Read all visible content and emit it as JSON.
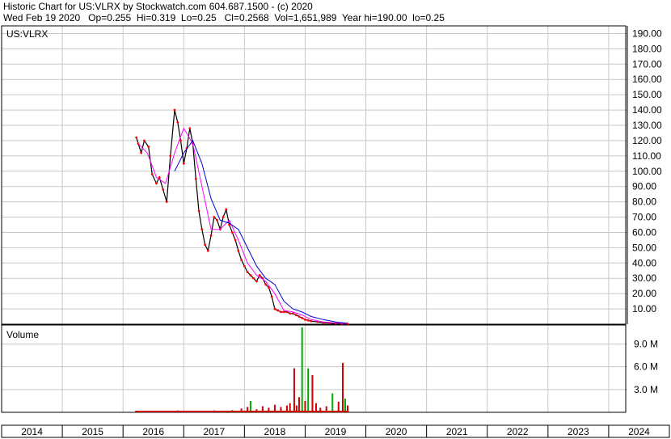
{
  "header": {
    "line1": "Historic Chart for US:VLRX by Stockwatch.com 604.687.1500 - (c) 2020",
    "line2": "Wed Feb 19 2020   Op=0.255  Hi=0.319  Lo=0.25   Cl=0.2568  Vol=1,651,989  Year hi=190.00  lo=0.25"
  },
  "chart_data": [
    {
      "type": "line",
      "title": "US:VLRX",
      "ylim": [
        0,
        195
      ],
      "yticks": [
        "10.00",
        "20.00",
        "30.00",
        "40.00",
        "50.00",
        "60.00",
        "70.00",
        "80.00",
        "90.00",
        "100.00",
        "110.00",
        "120.00",
        "130.00",
        "140.00",
        "150.00",
        "160.00",
        "170.00",
        "180.00",
        "190.00"
      ],
      "xlim": [
        2014,
        2025
      ],
      "xticks": [
        "2014",
        "2015",
        "2016",
        "2017",
        "2018",
        "2019",
        "2020",
        "2021",
        "2022",
        "2023",
        "2024"
      ],
      "grid": true,
      "colors": {
        "price": "#000000",
        "ma_short": "#ff00ff",
        "ma_long": "#0000cc",
        "close_mark": "#ff0000"
      },
      "series": [
        {
          "key": "price",
          "x": [
            2016.22,
            2016.25,
            2016.3,
            2016.35,
            2016.42,
            2016.48,
            2016.55,
            2016.6,
            2016.66,
            2016.72,
            2016.78,
            2016.85,
            2016.9,
            2016.95,
            2017.0,
            2017.05,
            2017.1,
            2017.15,
            2017.2,
            2017.25,
            2017.3,
            2017.35,
            2017.4,
            2017.45,
            2017.5,
            2017.55,
            2017.6,
            2017.65,
            2017.7,
            2017.75,
            2017.8,
            2017.85,
            2017.9,
            2017.95,
            2018.0,
            2018.05,
            2018.1,
            2018.15,
            2018.2,
            2018.25,
            2018.3,
            2018.35,
            2018.4,
            2018.45,
            2018.5,
            2018.55,
            2018.6,
            2018.65,
            2018.7,
            2018.75,
            2018.8,
            2018.85,
            2018.9,
            2018.95,
            2019.0,
            2019.05,
            2019.1,
            2019.2,
            2019.3,
            2019.4,
            2019.5,
            2019.6,
            2019.7
          ],
          "y": [
            122,
            118,
            112,
            120,
            116,
            98,
            92,
            96,
            88,
            80,
            110,
            140,
            132,
            120,
            105,
            115,
            128,
            118,
            95,
            74,
            62,
            52,
            48,
            58,
            70,
            68,
            62,
            70,
            75,
            65,
            60,
            55,
            48,
            42,
            38,
            34,
            32,
            30,
            28,
            32,
            30,
            26,
            24,
            18,
            10,
            9,
            8,
            8,
            8,
            7,
            7,
            6,
            5,
            4,
            3,
            2.5,
            2,
            1.5,
            1,
            0.8,
            0.5,
            0.35,
            0.26
          ]
        },
        {
          "key": "ma_short",
          "x": [
            2016.25,
            2016.4,
            2016.55,
            2016.7,
            2016.85,
            2017.0,
            2017.15,
            2017.3,
            2017.45,
            2017.6,
            2017.75,
            2017.9,
            2018.05,
            2018.2,
            2018.35,
            2018.5,
            2018.65,
            2018.8,
            2018.95,
            2019.1,
            2019.3,
            2019.5,
            2019.7
          ],
          "y": [
            118,
            112,
            96,
            92,
            112,
            128,
            118,
            90,
            62,
            62,
            68,
            55,
            40,
            32,
            28,
            20,
            9,
            8,
            6,
            3,
            1.5,
            0.8,
            0.3
          ]
        },
        {
          "key": "ma_long",
          "x": [
            2016.85,
            2017.0,
            2017.15,
            2017.3,
            2017.45,
            2017.6,
            2017.75,
            2017.9,
            2018.05,
            2018.2,
            2018.35,
            2018.5,
            2018.65,
            2018.8,
            2018.95,
            2019.1,
            2019.3,
            2019.5,
            2019.7
          ],
          "y": [
            100,
            112,
            120,
            105,
            82,
            68,
            66,
            62,
            50,
            38,
            30,
            26,
            15,
            10,
            8,
            5,
            3,
            1.5,
            0.6
          ]
        }
      ]
    },
    {
      "type": "bar",
      "title": "Volume",
      "ylim": [
        0,
        11500000
      ],
      "yticks": [
        "3.0 M",
        "6.0 M",
        "9.0 M"
      ],
      "xlim": [
        2014,
        2025
      ],
      "colors": {
        "up": "#00aa00",
        "down": "#cc0000"
      },
      "bars": [
        {
          "x": 2016.3,
          "v": 150000,
          "c": "down"
        },
        {
          "x": 2016.6,
          "v": 200000,
          "c": "down"
        },
        {
          "x": 2016.9,
          "v": 250000,
          "c": "down"
        },
        {
          "x": 2017.2,
          "v": 200000,
          "c": "down"
        },
        {
          "x": 2017.5,
          "v": 250000,
          "c": "down"
        },
        {
          "x": 2017.8,
          "v": 300000,
          "c": "up"
        },
        {
          "x": 2017.95,
          "v": 500000,
          "c": "down"
        },
        {
          "x": 2018.05,
          "v": 700000,
          "c": "down"
        },
        {
          "x": 2018.1,
          "v": 1500000,
          "c": "up"
        },
        {
          "x": 2018.2,
          "v": 400000,
          "c": "down"
        },
        {
          "x": 2018.3,
          "v": 800000,
          "c": "down"
        },
        {
          "x": 2018.4,
          "v": 600000,
          "c": "down"
        },
        {
          "x": 2018.5,
          "v": 1000000,
          "c": "down"
        },
        {
          "x": 2018.6,
          "v": 700000,
          "c": "down"
        },
        {
          "x": 2018.7,
          "v": 900000,
          "c": "down"
        },
        {
          "x": 2018.75,
          "v": 1200000,
          "c": "down"
        },
        {
          "x": 2018.82,
          "v": 5800000,
          "c": "down"
        },
        {
          "x": 2018.86,
          "v": 900000,
          "c": "down"
        },
        {
          "x": 2018.9,
          "v": 2000000,
          "c": "down"
        },
        {
          "x": 2018.95,
          "v": 11200000,
          "c": "up"
        },
        {
          "x": 2019.0,
          "v": 1500000,
          "c": "down"
        },
        {
          "x": 2019.05,
          "v": 5800000,
          "c": "up"
        },
        {
          "x": 2019.12,
          "v": 4900000,
          "c": "down"
        },
        {
          "x": 2019.18,
          "v": 1200000,
          "c": "down"
        },
        {
          "x": 2019.25,
          "v": 600000,
          "c": "down"
        },
        {
          "x": 2019.35,
          "v": 800000,
          "c": "down"
        },
        {
          "x": 2019.45,
          "v": 2500000,
          "c": "up"
        },
        {
          "x": 2019.55,
          "v": 1400000,
          "c": "down"
        },
        {
          "x": 2019.62,
          "v": 6500000,
          "c": "down"
        },
        {
          "x": 2019.66,
          "v": 1800000,
          "c": "up"
        },
        {
          "x": 2019.7,
          "v": 900000,
          "c": "down"
        }
      ]
    }
  ]
}
